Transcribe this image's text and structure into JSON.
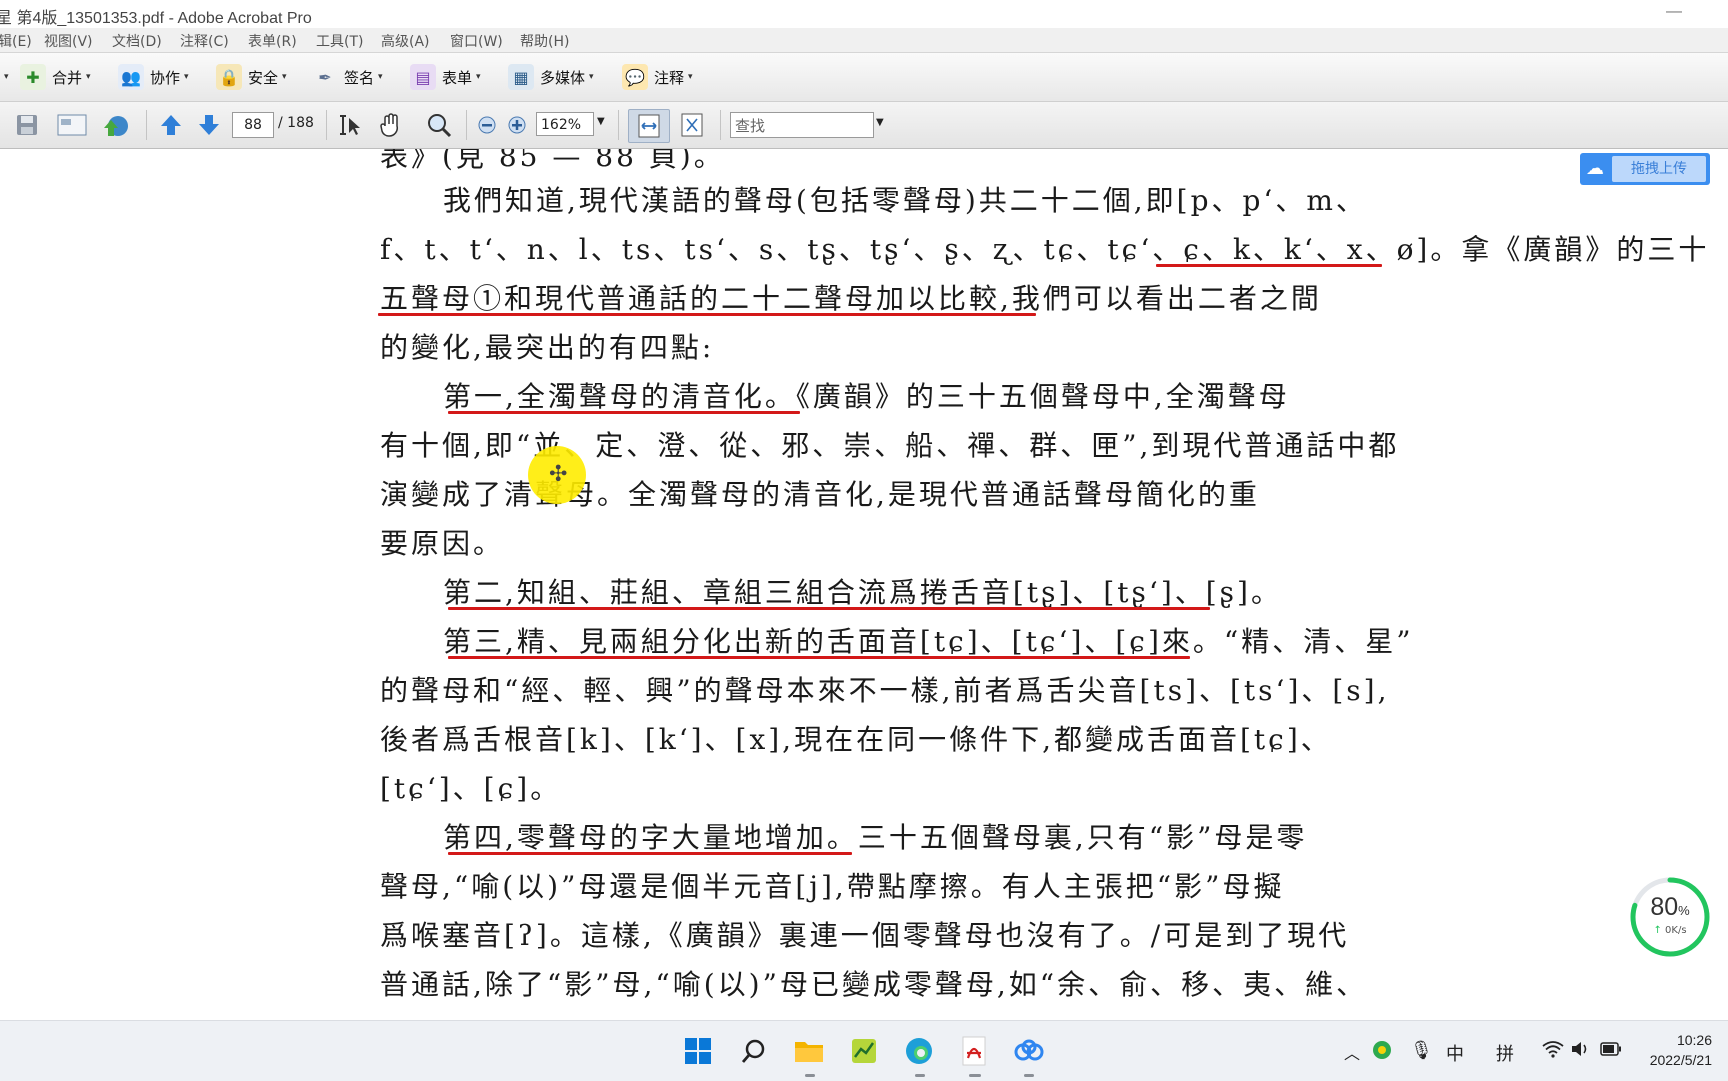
{
  "window": {
    "title": "星 第4版_13501353.pdf - Adobe Acrobat Pro",
    "minimize": "—"
  },
  "menu": [
    "辑(E)",
    "视图(V)",
    "文档(D)",
    "注释(C)",
    "表单(R)",
    "工具(T)",
    "高级(A)",
    "窗口(W)",
    "帮助(H)"
  ],
  "toolbar1": {
    "merge": "合并",
    "collab": "协作",
    "secure": "安全",
    "sign": "签名",
    "forms": "表单",
    "multimedia": "多媒体",
    "comment": "注释"
  },
  "toolbar2": {
    "page_current": "88",
    "page_total": "/ 188",
    "zoom": "162%",
    "find_placeholder": "查找"
  },
  "upload_button": "拖拽上传",
  "gauge": {
    "percent": "80",
    "percent_unit": "%",
    "speed": "0K/s",
    "level": 0.8
  },
  "document": {
    "lines": [
      "表》(見 85 — 88 頁)。",
      "我們知道,現代漢語的聲母(包括零聲母)共二十二個,即[p、p‘、m、",
      "f、t、t‘、n、l、ts、ts‘、s、tʂ、tʂ‘、ʂ、ʐ、tɕ、tɕ‘、ɕ、k、k‘、x、ø]。拿《廣韻》的三十",
      "五聲母①和現代普通話的二十二聲母加以比較,我們可以看出二者之間",
      "的變化,最突出的有四點:",
      "第一,全濁聲母的清音化。《廣韻》的三十五個聲母中,全濁聲母",
      "有十個,即“並、定、澄、從、邪、崇、船、禪、群、匣”,到現代普通話中都",
      "演變成了清聲母。全濁聲母的清音化,是現代普通話聲母簡化的重",
      "要原因。",
      "第二,知組、莊組、章組三組合流爲捲舌音[tʂ]、[tʂ‘]、[ʂ]。",
      "第三,精、見兩組分化出新的舌面音[tɕ]、[tɕ‘]、[ɕ]來。“精、清、星”",
      "的聲母和“經、輕、興”的聲母本來不一樣,前者爲舌尖音[ts]、[ts‘]、[s],",
      "後者爲舌根音[k]、[k‘]、[x],現在在同一條件下,都變成舌面音[tɕ]、",
      "[tɕ‘]、[ɕ]。",
      "第四,零聲母的字大量地增加。三十五個聲母裏,只有“影”母是零",
      "聲母,“喻(以)”母還是個半元音[j],帶點摩擦。有人主張把“影”母擬",
      "爲喉塞音[ʔ]。這樣,《廣韻》裏連一個零聲母也沒有了。/可是到了現代",
      "普通話,除了“影”母,“喻(以)”母已變成零聲母,如“余、俞、移、夷、維、"
    ]
  },
  "taskbar": {
    "ime_lang": "中",
    "ime_mode": "拼",
    "time": "10:26",
    "date": "2022/5/21"
  },
  "colors": {
    "underline": "#d31818",
    "upload": "#3b8ef0",
    "gauge": "#22c55e"
  }
}
